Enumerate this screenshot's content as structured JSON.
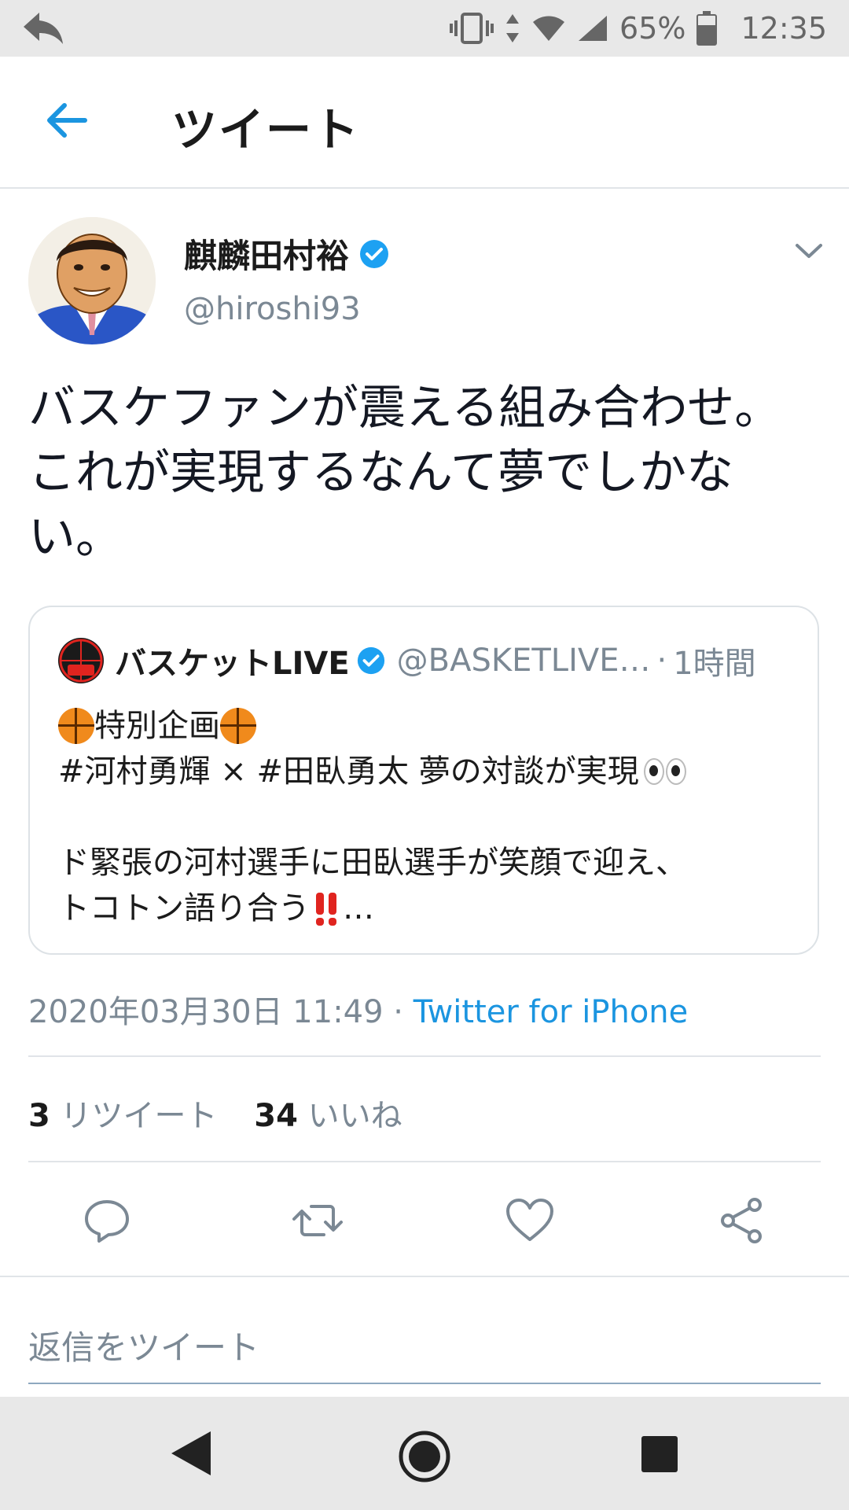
{
  "status_bar": {
    "battery": "65%",
    "time": "12:35",
    "icons": [
      "back-arrow-icon",
      "vibrate-icon",
      "data-arrows-icon",
      "wifi-icon",
      "signal-icon",
      "battery-icon"
    ]
  },
  "header": {
    "title": "ツイート"
  },
  "tweet": {
    "author_name": "麒麟田村裕",
    "author_handle": "@hiroshi93",
    "text": "バスケファンが震える組み合わせ。これが実現するなんて夢でしかない。",
    "quote": {
      "name": "バスケットLIVE",
      "handle": "@BASKETLIVE…",
      "dot": "·",
      "time": "1時間",
      "lines": {
        "l1": "特別企画",
        "l2": "#河村勇輝 × #田臥勇太 夢の対談が実現",
        "l3": "ド緊張の河村選手に田臥選手が笑顔で迎え、",
        "l4a": "トコトン語り合う",
        "l4b": "…"
      }
    },
    "timestamp": "2020年03月30日 11:49",
    "meta_dot": " · ",
    "source": "Twitter for iPhone",
    "retweet_count": "3",
    "retweet_label": "リツイート",
    "like_count": "34",
    "like_label": "いいね"
  },
  "reply_placeholder": "返信をツイート",
  "colors": {
    "accent": "#1b95e0",
    "muted": "#7b8894",
    "verified": "#1da1f2"
  }
}
